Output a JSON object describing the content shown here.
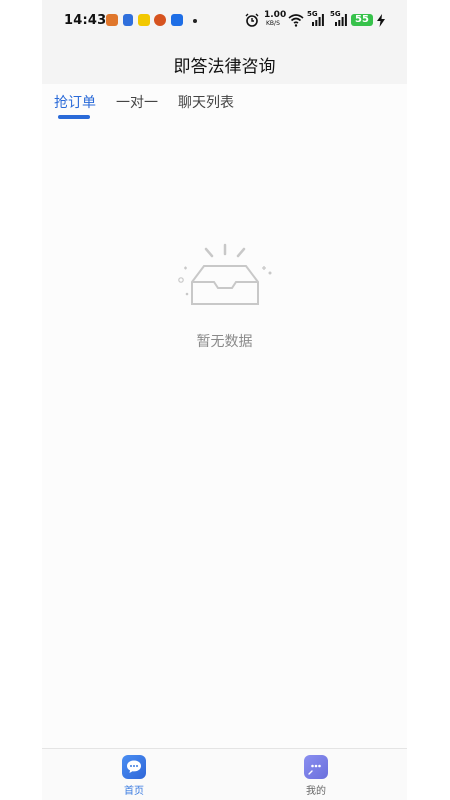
{
  "statusbar": {
    "time": "14:43",
    "speed": "1.00",
    "speed_unit": "KB/S",
    "network1": "5G",
    "network2": "5G",
    "battery": "55"
  },
  "header": {
    "title": "即答法律咨询"
  },
  "tabs": [
    {
      "label": "抢订单",
      "active": true
    },
    {
      "label": "一对一",
      "active": false
    },
    {
      "label": "聊天列表",
      "active": false
    }
  ],
  "empty_state": {
    "text": "暂无数据"
  },
  "bottom_nav": [
    {
      "label": "首页",
      "icon": "chat-bubble-icon",
      "active": true
    },
    {
      "label": "我的",
      "icon": "message-dots-icon",
      "active": false
    }
  ],
  "colors": {
    "accent": "#2a6ad8",
    "battery": "#37c24b"
  }
}
